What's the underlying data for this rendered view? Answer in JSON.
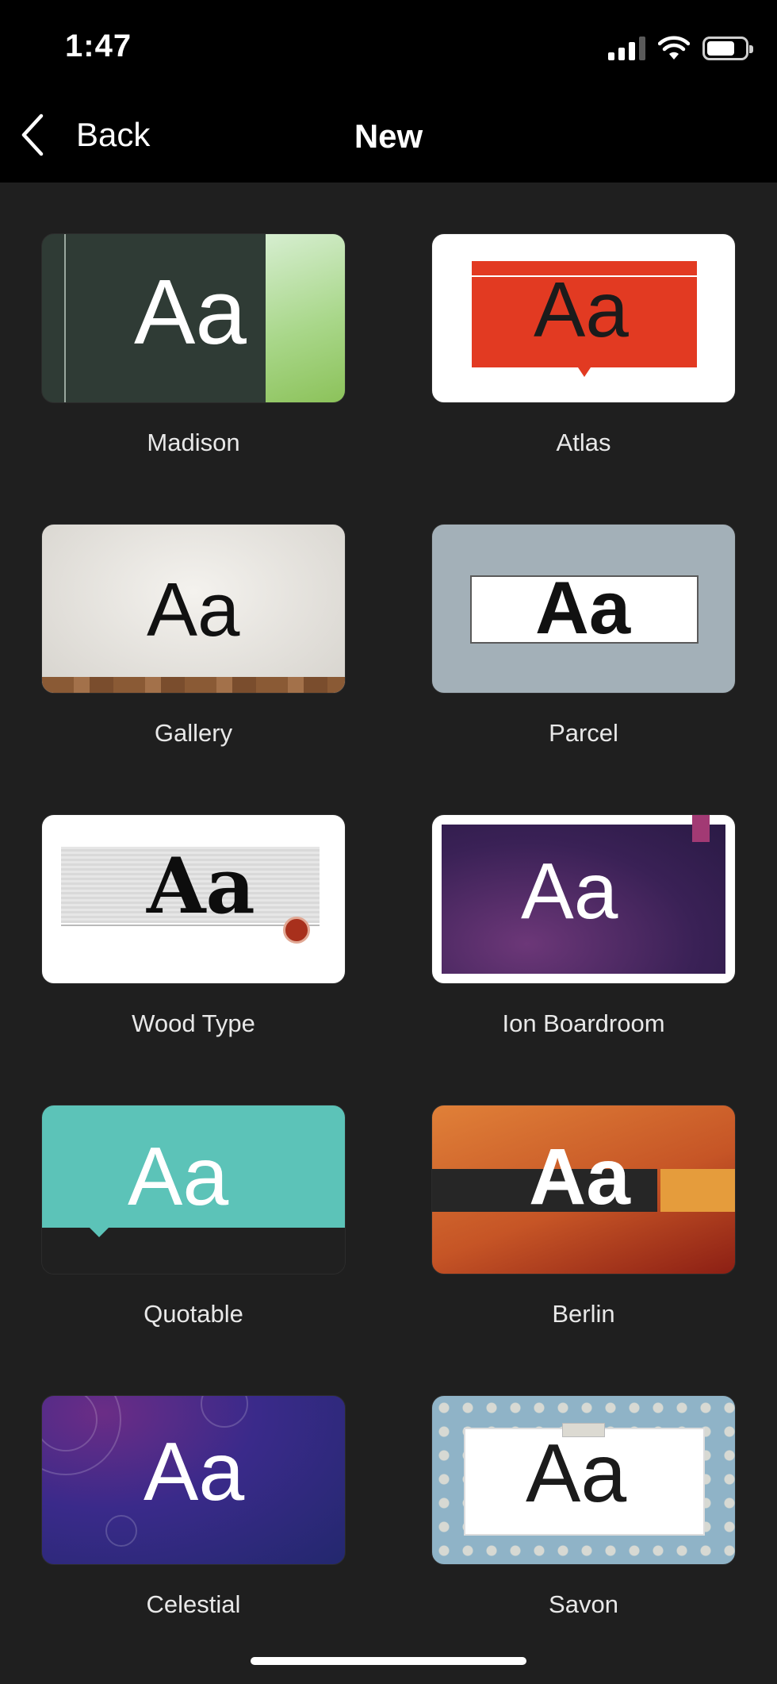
{
  "status_bar": {
    "time": "1:47"
  },
  "nav": {
    "back_label": "Back",
    "title": "New"
  },
  "templates": [
    {
      "name": "Madison",
      "sample": "Aa"
    },
    {
      "name": "Atlas",
      "sample": "Aa"
    },
    {
      "name": "Gallery",
      "sample": "Aa"
    },
    {
      "name": "Parcel",
      "sample": "Aa"
    },
    {
      "name": "Wood Type",
      "sample": "Aa"
    },
    {
      "name": "Ion Boardroom",
      "sample": "Aa"
    },
    {
      "name": "Quotable",
      "sample": "Aa"
    },
    {
      "name": "Berlin",
      "sample": "Aa"
    },
    {
      "name": "Celestial",
      "sample": "Aa"
    },
    {
      "name": "Savon",
      "sample": "Aa"
    }
  ],
  "colors": {
    "background": "#1f1f1f",
    "bar": "#000000",
    "text": "#ffffff"
  }
}
